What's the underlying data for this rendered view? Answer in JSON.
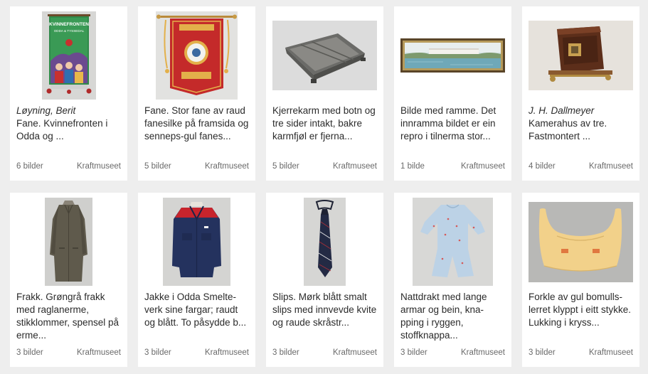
{
  "items": [
    {
      "creator": "Løyning, Berit",
      "title": "Fane. Kvinnefronten i Odda og ...",
      "count": "6 bilder",
      "owner": "Kraftmuseet",
      "icon": "banner-image"
    },
    {
      "creator": "",
      "title": "Fane. Stor fane av raud fanesilke på framsida og senneps-gul fanes...",
      "count": "5 bilder",
      "owner": "Kraftmuseet",
      "icon": "banner-image"
    },
    {
      "creator": "",
      "title": "Kjerrekarm med botn og tre sider intakt, bakre karmfjøl er fjerna...",
      "count": "5 bilder",
      "owner": "Kraftmuseet",
      "icon": "cart-box-image"
    },
    {
      "creator": "",
      "title": "Bilde med ramme. Det innramma bildet er ein repro i tilnerma stor...",
      "count": "1 bilde",
      "owner": "Kraftmuseet",
      "icon": "framed-picture-image"
    },
    {
      "creator": "J. H. Dallmeyer",
      "title": "Kamerahus av tre. Fastmontert ...",
      "count": "4 bilder",
      "owner": "Kraftmuseet",
      "icon": "camera-image"
    },
    {
      "creator": "",
      "title": "Frakk. Grøngrå frakk med raglanerme, stikklommer, spensel på erme...",
      "count": "3 bilder",
      "owner": "Kraftmuseet",
      "icon": "coat-image"
    },
    {
      "creator": "",
      "title": "Jakke i Odda Smelte-verk sine fargar; raudt og blått. To påsydde b...",
      "count": "3 bilder",
      "owner": "Kraftmuseet",
      "icon": "jacket-image"
    },
    {
      "creator": "",
      "title": "Slips. Mørk blått smalt slips med innvevde kvite og raude skråstr...",
      "count": "3 bilder",
      "owner": "Kraftmuseet",
      "icon": "tie-image"
    },
    {
      "creator": "",
      "title": "Nattdrakt med lange armar og bein, kna-pping i ryggen, stoffknappa...",
      "count": "3 bilder",
      "owner": "Kraftmuseet",
      "icon": "pajamas-image"
    },
    {
      "creator": "",
      "title": "Forkle av gul bomulls-lerret klyppt i eitt stykke. Lukking i kryss...",
      "count": "3 bilder",
      "owner": "Kraftmuseet",
      "icon": "apron-image"
    }
  ],
  "thumbs": {
    "banner1_title": "KVINNEFRONTEN",
    "banner1_sub": "ODDA & TYSSEDAL"
  },
  "colors": {
    "page_bg": "#eeeeee",
    "card_bg": "#ffffff",
    "meta_text": "#6a6a6a"
  }
}
